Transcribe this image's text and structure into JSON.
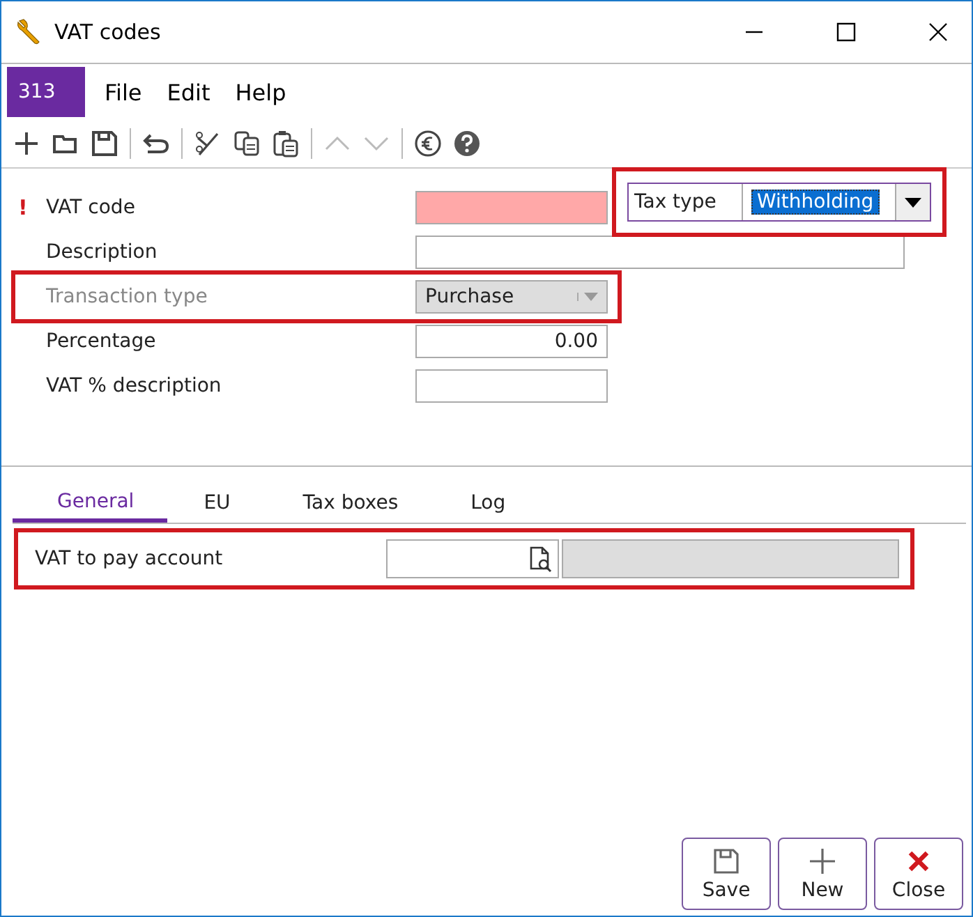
{
  "window": {
    "title": "VAT codes"
  },
  "menu": {
    "badge": "313",
    "items": [
      "File",
      "Edit",
      "Help"
    ]
  },
  "form": {
    "fields": [
      {
        "kind": "text",
        "label": "VAT code",
        "required_mark": "!",
        "invalid": true,
        "highlighted": false,
        "disabled": false
      },
      {
        "kind": "wide",
        "label": "Description",
        "invalid": false,
        "highlighted": false,
        "disabled": false
      },
      {
        "kind": "select",
        "label": "Transaction type",
        "value": "Purchase",
        "invalid": false,
        "highlighted": true,
        "disabled": true
      },
      {
        "kind": "number",
        "label": "Percentage",
        "value": "0.00",
        "invalid": false,
        "highlighted": false,
        "disabled": false
      },
      {
        "kind": "text",
        "label": "VAT % description",
        "invalid": false,
        "highlighted": false,
        "disabled": false
      }
    ],
    "tax_type": {
      "label": "Tax type",
      "value": "Withholding",
      "highlighted": true
    }
  },
  "tabs": [
    {
      "label": "General",
      "selected": true
    },
    {
      "label": "EU",
      "selected": false
    },
    {
      "label": "Tax boxes",
      "selected": false
    },
    {
      "label": "Log",
      "selected": false
    }
  ],
  "general": {
    "label": "VAT to pay account",
    "highlighted": true
  },
  "buttons": [
    {
      "kind": "save",
      "label": "Save"
    },
    {
      "kind": "new",
      "label": "New"
    },
    {
      "kind": "close",
      "label": "Close"
    }
  ]
}
